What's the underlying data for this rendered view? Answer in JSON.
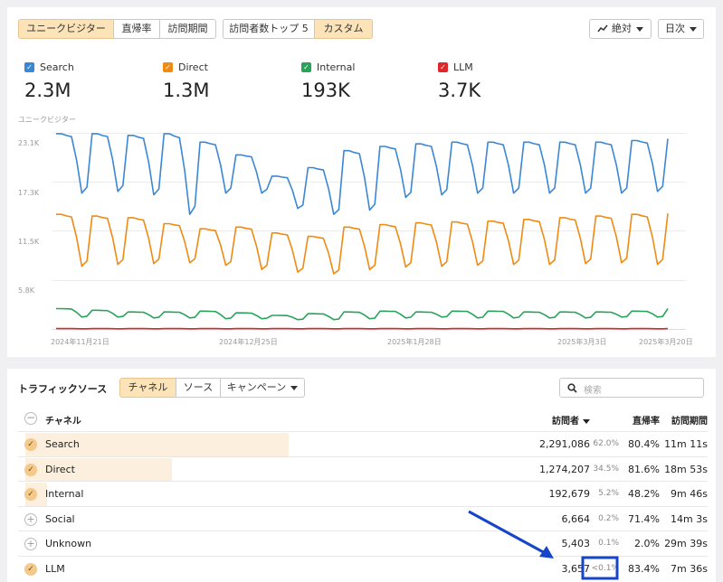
{
  "toolbar": {
    "metric_buttons": [
      "ユニークビジター",
      "直帰率",
      "訪問期間"
    ],
    "top_visitors_button": "訪問者数トップ 5",
    "custom_button": "カスタム",
    "mode_dropdown": "絶対",
    "interval_dropdown": "日次"
  },
  "legend": [
    {
      "name": "Search",
      "value": "2.3M",
      "color": "#3a87d6"
    },
    {
      "name": "Direct",
      "value": "1.3M",
      "color": "#ef8a12"
    },
    {
      "name": "Internal",
      "value": "193K",
      "color": "#2aa35a"
    },
    {
      "name": "LLM",
      "value": "3.7K",
      "color": "#e0262a"
    }
  ],
  "chart_data": {
    "type": "line",
    "ylabel": "ユニークビジター",
    "yticks": [
      "23.1K",
      "17.3K",
      "11.5K",
      "5.8K"
    ],
    "ytick_values": [
      23100,
      17300,
      11500,
      5800
    ],
    "xticks": [
      "2024年11月21日",
      "2024年12月25日",
      "2025年1月28日",
      "2025年3月3日",
      "2025年3月20日"
    ],
    "ylim": [
      0,
      23100
    ],
    "days": 120,
    "series": [
      {
        "name": "Search",
        "color": "#3a87d6",
        "weekly_high": [
          23000,
          23000,
          22800,
          23000,
          22000,
          20500,
          18000,
          19000,
          21000,
          21500,
          21800,
          22000,
          22000,
          22000,
          22000,
          22000,
          22200,
          22400
        ],
        "weekly_low": [
          16000,
          16200,
          15800,
          13500,
          16000,
          16000,
          14200,
          13500,
          14000,
          15500,
          15800,
          16000,
          16000,
          16000,
          16000,
          16000,
          16200,
          19000
        ]
      },
      {
        "name": "Direct",
        "color": "#ef8a12",
        "weekly_high": [
          13500,
          13300,
          13100,
          12400,
          11800,
          12000,
          11300,
          10900,
          12000,
          12300,
          12500,
          12600,
          12700,
          12900,
          13100,
          13300,
          13500,
          13600
        ],
        "weekly_low": [
          7400,
          7600,
          7700,
          7800,
          7500,
          7000,
          6700,
          6500,
          7000,
          7300,
          7400,
          7500,
          7600,
          7600,
          7700,
          7800,
          7600,
          7600
        ]
      },
      {
        "name": "Internal",
        "color": "#2aa35a",
        "weekly_high": [
          2400,
          2200,
          2000,
          2000,
          2100,
          1900,
          1600,
          1800,
          2000,
          2100,
          2000,
          2100,
          2100,
          2000,
          2000,
          2000,
          2100,
          2400
        ],
        "weekly_low": [
          1400,
          1400,
          1300,
          1300,
          1200,
          1200,
          1100,
          1100,
          1200,
          1300,
          1400,
          1300,
          1300,
          1300,
          1300,
          1400,
          1400,
          1600
        ]
      },
      {
        "name": "LLM",
        "color": "#e0262a",
        "weekly_high": [
          40,
          40,
          40,
          40,
          40,
          40,
          40,
          40,
          40,
          40,
          40,
          40,
          40,
          40,
          40,
          40,
          40,
          40
        ],
        "weekly_low": [
          20,
          20,
          20,
          20,
          20,
          20,
          20,
          20,
          20,
          20,
          20,
          20,
          20,
          20,
          20,
          20,
          20,
          20
        ]
      }
    ]
  },
  "traffic": {
    "title": "トラフィックソース",
    "tabs": [
      "チャネル",
      "ソース",
      "キャンペーン"
    ],
    "search_placeholder": "検索",
    "headers": {
      "channel": "チャネル",
      "visitors": "訪問者",
      "bounce": "直帰率",
      "duration": "訪問期間"
    },
    "rows": [
      {
        "name": "Search",
        "visitors": "2,291,086",
        "pct": "62.0%",
        "share": 0.62,
        "bounce": "80.4%",
        "duration": "11m 11s",
        "selected": true
      },
      {
        "name": "Direct",
        "visitors": "1,274,207",
        "pct": "34.5%",
        "share": 0.345,
        "bounce": "81.6%",
        "duration": "18m 53s",
        "selected": true
      },
      {
        "name": "Internal",
        "visitors": "192,679",
        "pct": "5.2%",
        "share": 0.052,
        "bounce": "48.2%",
        "duration": "9m 46s",
        "selected": true
      },
      {
        "name": "Social",
        "visitors": "6,664",
        "pct": "0.2%",
        "share": 0.002,
        "bounce": "71.4%",
        "duration": "14m 3s",
        "selected": false
      },
      {
        "name": "Unknown",
        "visitors": "5,403",
        "pct": "0.1%",
        "share": 0.001,
        "bounce": "2.0%",
        "duration": "29m 39s",
        "selected": false
      },
      {
        "name": "LLM",
        "visitors": "3,657",
        "pct": "<0.1%",
        "share": 0.0005,
        "bounce": "83.4%",
        "duration": "7m 36s",
        "selected": true
      }
    ]
  },
  "annotation": {
    "arrow_color": "#1546c8",
    "box_color": "#1546c8"
  }
}
